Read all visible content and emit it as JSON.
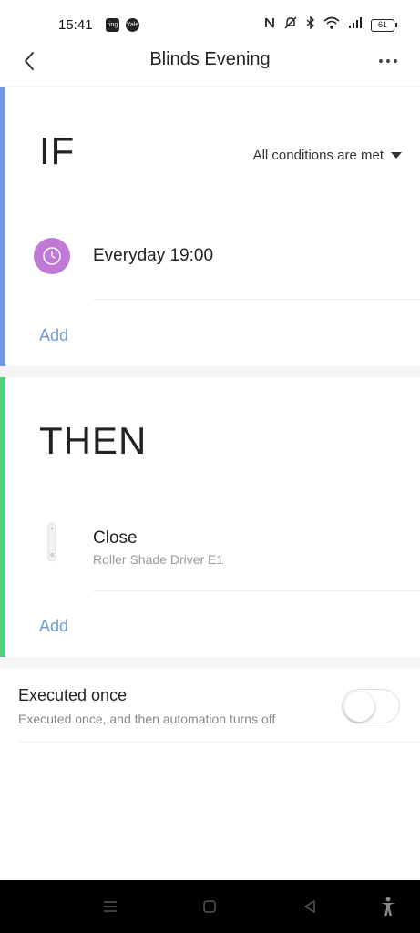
{
  "status_bar": {
    "time": "15:41",
    "app_icons": [
      "ring",
      "Yale"
    ],
    "battery": "61",
    "icons": [
      "nfc-icon",
      "mute-icon",
      "bluetooth-icon",
      "wifi-icon",
      "signal-icon",
      "battery-icon"
    ]
  },
  "header": {
    "title": "Blinds Evening",
    "back_icon": "chevron-left-icon",
    "more_icon": "more-dots-icon"
  },
  "if_section": {
    "title": "IF",
    "condition_mode": "All conditions are met",
    "accent_color": "#6e9be0",
    "items": [
      {
        "title": "Everyday 19:00",
        "icon": "clock-icon",
        "icon_color": "#c07ad6"
      }
    ],
    "add_label": "Add"
  },
  "then_section": {
    "title": "THEN",
    "accent_color": "#4fcf7f",
    "items": [
      {
        "title": "Close",
        "subtitle": "Roller Shade Driver E1",
        "icon": "roller-shade-icon"
      }
    ],
    "add_label": "Add"
  },
  "executed_once": {
    "title": "Executed once",
    "subtitle": "Executed once, and then automation turns off",
    "enabled": false
  },
  "nav_bar": {
    "buttons": [
      "menu-icon",
      "home-icon",
      "back-icon",
      "accessibility-icon"
    ]
  },
  "colors": {
    "link": "#6f9ccc",
    "if_accent": "#6e9be0",
    "then_accent": "#4fcf7f"
  }
}
